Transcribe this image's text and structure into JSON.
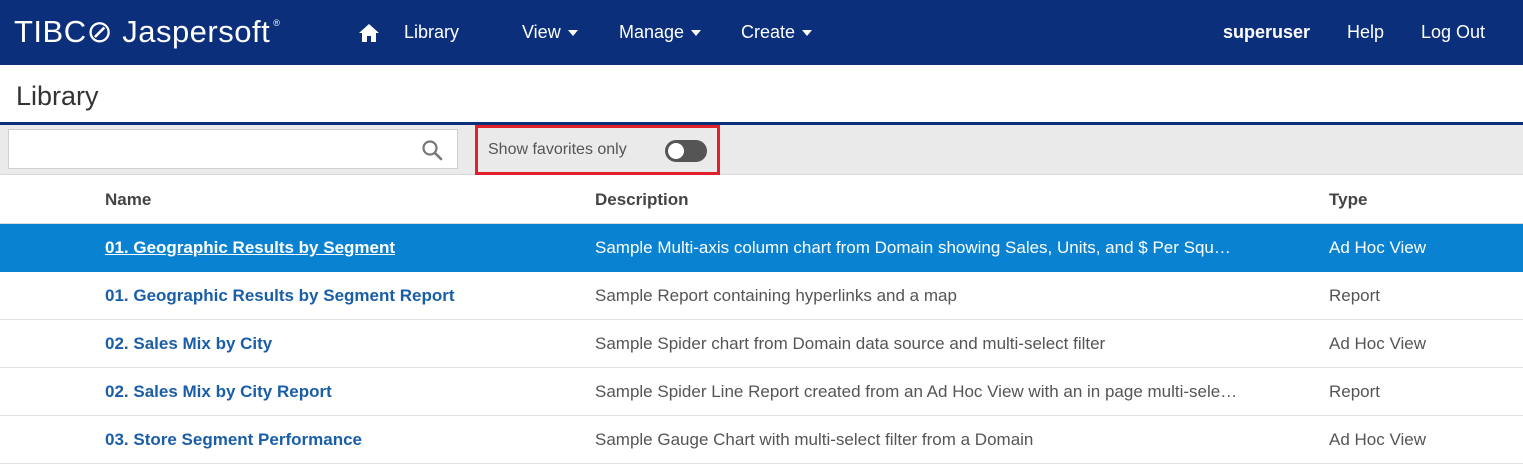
{
  "header": {
    "logo_text": "TIBC⊘ Jaspersoft",
    "logo_reg": "®",
    "nav": {
      "library": "Library",
      "view": "View",
      "manage": "Manage",
      "create": "Create"
    },
    "user": "superuser",
    "help": "Help",
    "logout": "Log Out",
    "bg_color": "#0b2f7a"
  },
  "page": {
    "title": "Library"
  },
  "toolbar": {
    "search_value": "",
    "search_placeholder": "",
    "favorites_label": "Show favorites only",
    "favorites_on": false,
    "highlight_color": "#e0202a"
  },
  "table": {
    "columns": {
      "name": "Name",
      "description": "Description",
      "type": "Type"
    },
    "rows": [
      {
        "favorite": true,
        "selected": true,
        "name": "01. Geographic Results by Segment",
        "description": "Sample Multi-axis column chart from Domain showing Sales, Units, and $ Per Squ…",
        "type": "Ad Hoc View"
      },
      {
        "favorite": false,
        "selected": false,
        "name": "01. Geographic Results by Segment Report",
        "description": "Sample Report containing hyperlinks and a map",
        "type": "Report"
      },
      {
        "favorite": false,
        "selected": false,
        "name": "02. Sales Mix by City",
        "description": "Sample Spider chart from Domain data source and multi-select filter",
        "type": "Ad Hoc View"
      },
      {
        "favorite": true,
        "selected": false,
        "name": "02. Sales Mix by City Report",
        "description": "Sample Spider Line Report created from an Ad Hoc View with an in page multi-sele…",
        "type": "Report"
      },
      {
        "favorite": false,
        "selected": false,
        "name": "03. Store Segment Performance",
        "description": "Sample Gauge Chart with multi-select filter from a Domain",
        "type": "Ad Hoc View"
      }
    ],
    "selected_color": "#0a82d2",
    "link_color": "#1a5ea8"
  }
}
